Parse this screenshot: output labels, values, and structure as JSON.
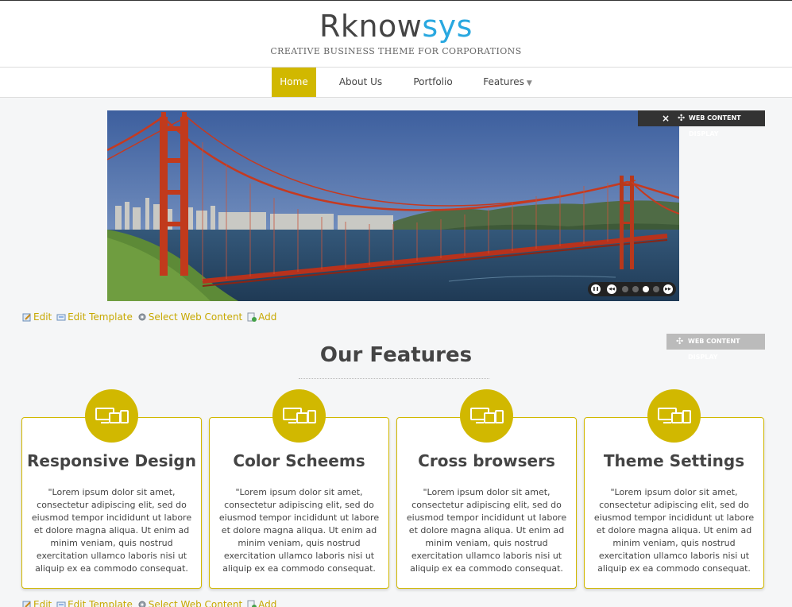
{
  "header": {
    "logo_part1": "Rknow",
    "logo_part2": "sys",
    "tagline": "CREATIVE BUSINESS THEME FOR CORPORATIONS"
  },
  "nav": {
    "items": [
      {
        "label": "Home"
      },
      {
        "label": "About Us"
      },
      {
        "label": "Portfolio"
      },
      {
        "label": "Features"
      }
    ]
  },
  "portlet": {
    "close": "×",
    "move": "✣",
    "title": "WEB CONTENT DISPLAY"
  },
  "slider": {
    "pause": "❚❚",
    "prev": "◀◀",
    "next": "▶▶",
    "slide_count": 4,
    "active_slide": 3
  },
  "edit_links": {
    "edit": "Edit",
    "edit_template": "Edit Template",
    "select_web_content": "Select Web Content",
    "add": "Add"
  },
  "features": {
    "title": "Our Features",
    "cards": [
      {
        "title": "Responsive Design",
        "text": "\"Lorem ipsum dolor sit amet, consectetur adipiscing elit, sed do eiusmod tempor incididunt ut labore et dolore magna aliqua. Ut enim ad minim veniam, quis nostrud exercitation ullamco laboris nisi ut aliquip ex ea commodo consequat."
      },
      {
        "title": "Color Scheems",
        "text": "\"Lorem ipsum dolor sit amet, consectetur adipiscing elit, sed do eiusmod tempor incididunt ut labore et dolore magna aliqua. Ut enim ad minim veniam, quis nostrud exercitation ullamco laboris nisi ut aliquip ex ea commodo consequat."
      },
      {
        "title": "Cross browsers",
        "text": "\"Lorem ipsum dolor sit amet, consectetur adipiscing elit, sed do eiusmod tempor incididunt ut labore et dolore magna aliqua. Ut enim ad minim veniam, quis nostrud exercitation ullamco laboris nisi ut aliquip ex ea commodo consequat."
      },
      {
        "title": "Theme Settings",
        "text": "\"Lorem ipsum dolor sit amet, consectetur adipiscing elit, sed do eiusmod tempor incididunt ut labore et dolore magna aliqua. Ut enim ad minim veniam, quis nostrud exercitation ullamco laboris nisi ut aliquip ex ea commodo consequat."
      }
    ]
  },
  "colors": {
    "accent": "#d1b800",
    "logo_blue": "#29a8e0",
    "link": "#c7a800"
  }
}
